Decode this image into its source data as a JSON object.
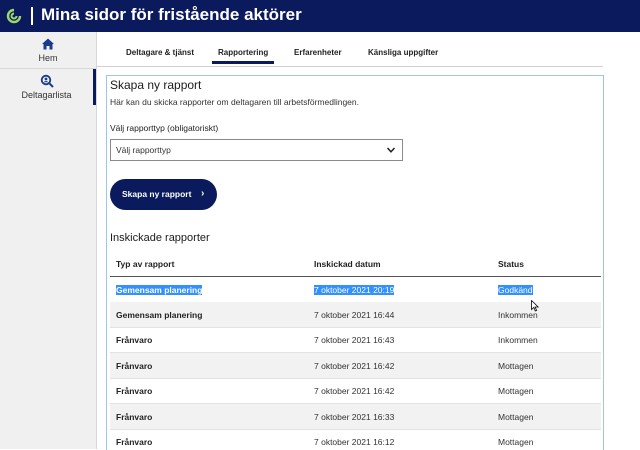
{
  "app": {
    "title": "Mina sidor för fristående aktörer",
    "logo_icon": "circle-logo-icon",
    "brand_color": "#0a1a5c"
  },
  "sidebar": {
    "items": [
      {
        "label": "Hem",
        "icon": "home-icon"
      },
      {
        "label": "Deltagarlista",
        "icon": "search-user-icon",
        "active": true
      }
    ]
  },
  "tabs": [
    {
      "label": "Deltagare & tjänst"
    },
    {
      "label": "Rapportering",
      "active": true
    },
    {
      "label": "Erfarenheter"
    },
    {
      "label": "Känsliga uppgifter"
    }
  ],
  "create_report": {
    "heading": "Skapa ny rapport",
    "description": "Här kan du skicka rapporter om deltagaren till arbetsförmedlingen.",
    "select_label": "Välj rapporttyp (obligatoriskt)",
    "select_value": "Välj rapporttyp",
    "button_label": "Skapa ny rapport",
    "button_arrow": "›"
  },
  "submitted": {
    "heading": "Inskickade rapporter",
    "columns": [
      "Typ av rapport",
      "Inskickad datum",
      "Status"
    ],
    "rows": [
      {
        "type": "Gemensam planering",
        "date": "7 oktober 2021 20:19",
        "status": "Godkänd",
        "selected": true
      },
      {
        "type": "Gemensam planering",
        "date": "7 oktober 2021 16:44",
        "status": "Inkommen"
      },
      {
        "type": "Frånvaro",
        "date": "7 oktober 2021 16:43",
        "status": "Inkommen"
      },
      {
        "type": "Frånvaro",
        "date": "7 oktober 2021 16:42",
        "status": "Mottagen"
      },
      {
        "type": "Frånvaro",
        "date": "7 oktober 2021 16:42",
        "status": "Mottagen"
      },
      {
        "type": "Frånvaro",
        "date": "7 oktober 2021 16:33",
        "status": "Mottagen"
      },
      {
        "type": "Frånvaro",
        "date": "7 oktober 2021 16:12",
        "status": "Mottagen"
      }
    ]
  }
}
